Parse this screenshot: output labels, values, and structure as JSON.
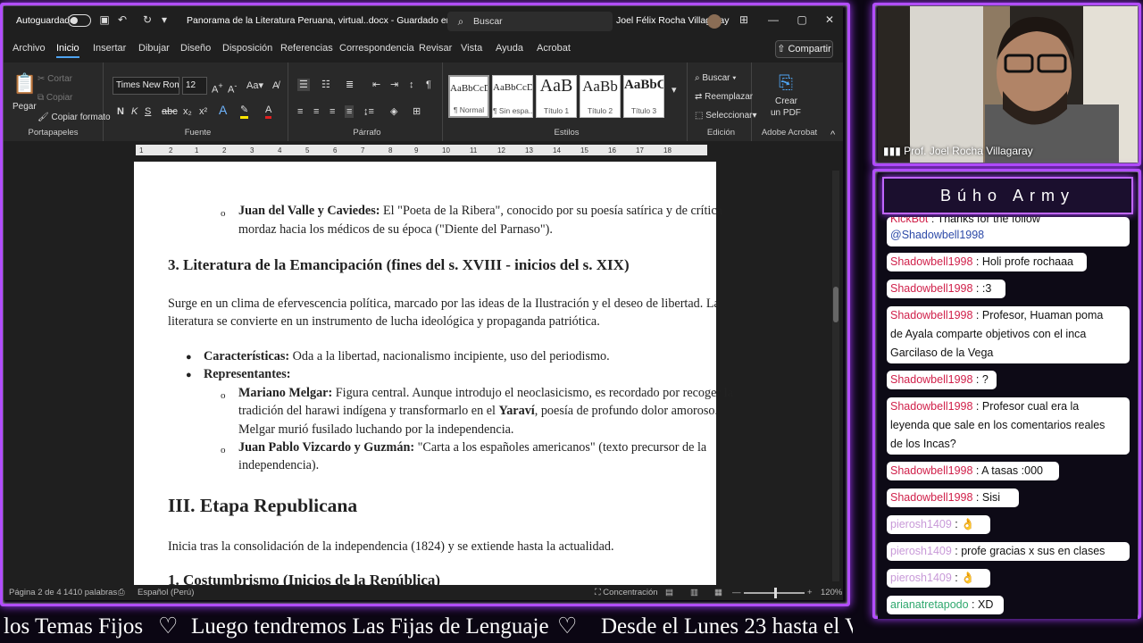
{
  "word": {
    "autosave_label": "Autoguardado",
    "doc_title": "Panorama de la Literatura Peruana, virtual..docx  -  Guardado en Este PC  ▾",
    "search_placeholder": "Buscar",
    "user_name": "Joel Félix Rocha Villagaray",
    "menu": [
      "Archivo",
      "Inicio",
      "Insertar",
      "Dibujar",
      "Diseño",
      "Disposición",
      "Referencias",
      "Correspondencia",
      "Revisar",
      "Vista",
      "Ayuda",
      "Acrobat"
    ],
    "share_label": "Compartir",
    "ribbon": {
      "clipboard": {
        "paste": "Pegar",
        "cut": "Cortar",
        "copy": "Copiar",
        "format_painter": "Copiar formato",
        "group": "Portapapeles"
      },
      "font": {
        "name": "Times New Roma",
        "size": "12",
        "group": "Fuente"
      },
      "paragraph": {
        "group": "Párrafo"
      },
      "styles": {
        "items": [
          {
            "preview": "AaBbCcDc",
            "name": "¶ Normal"
          },
          {
            "preview": "AaBbCcDc",
            "name": "¶ Sin espa..."
          },
          {
            "preview": "AaB",
            "name": "Título 1"
          },
          {
            "preview": "AaBb",
            "name": "Título 2"
          },
          {
            "preview": "AaBbC",
            "name": "Título 3"
          }
        ],
        "group": "Estilos"
      },
      "editing": {
        "find": "Buscar",
        "replace": "Reemplazar",
        "select": "Seleccionar",
        "group": "Edición"
      },
      "acrobat": {
        "create_pdf_1": "Crear",
        "create_pdf_2": "un PDF",
        "group": "Adobe Acrobat"
      }
    },
    "ruler_ticks": [
      "1",
      "2",
      "1",
      "2",
      "3",
      "4",
      "5",
      "6",
      "7",
      "8",
      "9",
      "10",
      "11",
      "12",
      "13",
      "14",
      "15",
      "16",
      "17",
      "18"
    ],
    "document": {
      "sub1_name": "Juan del Valle y Caviedes:",
      "sub1_line1": " El \"Poeta de la Ribera\", conocido por su poesía satírica y de crítica",
      "sub1_line2": "mordaz hacia los médicos de su época (\"Diente del Parnaso\").",
      "section3_heading": "3. Literatura de la Emancipación (fines del s. XVIII - inicios del s. XIX)",
      "section3_p1": "Surge en un clima de efervescencia política, marcado por las ideas de la Ilustración y el deseo de libertad. La",
      "section3_p2": "literatura se convierte en un instrumento de lucha ideológica y propaganda patriótica.",
      "bullet1_label": "Características:",
      "bullet1_text": " Oda a la libertad, nacionalismo incipiente, uso del periodismo.",
      "bullet2_label": "Representantes:",
      "melgar_name": "Mariano Melgar:",
      "melgar_l1": " Figura central. Aunque introdujo el neoclasicismo, es recordado por recoger la",
      "melgar_l2a": "tradición del harawi indígena y transformarlo en el ",
      "melgar_l2b": "Yaraví",
      "melgar_l2c": ", poesía de profundo dolor amoroso.",
      "melgar_l3": "Melgar murió fusilado luchando por la independencia.",
      "vizcardo_name": "Juan Pablo Vizcardo y Guzmán:",
      "vizcardo_l1": " \"Carta a los españoles americanos\" (texto precursor de la",
      "vizcardo_l2": "independencia).",
      "stage3_heading": "III. Etapa Republicana",
      "stage3_p": "Inicia tras la consolidación de la independencia (1824) y se extiende hasta la actualidad.",
      "next_heading": "1. Costumbrismo (Inicios de la República)"
    },
    "status": {
      "page": "Página 2 de 4",
      "words": "1410 palabras",
      "language": "Español (Perú)",
      "focus": "Concentración",
      "zoom": "120%"
    }
  },
  "ticker": [
    "los Temas Fijos",
    "♡",
    "Luego tendremos Las Fijas de Lenguaje",
    "♡",
    "Desde el Lunes 23 hasta el V"
  ],
  "webcam": {
    "label": "Prof. Joel Rocha Villagaray"
  },
  "chat": {
    "title": "Búho Army",
    "messages": [
      {
        "user": "KickBot",
        "text": " : Thanks for the follow",
        "line2": "@Shadowbell1998",
        "kind": "kick"
      },
      {
        "user": "Shadowbell1998",
        "text": " : Holi profe rochaaa",
        "kind": "shadow"
      },
      {
        "user": "Shadowbell1998",
        "text": " : :3",
        "kind": "shadow"
      },
      {
        "user": "Shadowbell1998",
        "text": " : Profesor, Huaman poma",
        "line2": "de Ayala comparte objetivos con el inca",
        "line3": "Garcilaso de la Vega",
        "kind": "shadow"
      },
      {
        "user": "Shadowbell1998",
        "text": " : ?",
        "kind": "shadow"
      },
      {
        "user": "Shadowbell1998",
        "text": " : Profesor cual era la",
        "line2": "leyenda que sale en los comentarios reales",
        "line3": "de los Incas?",
        "kind": "shadow"
      },
      {
        "user": "Shadowbell1998",
        "text": " : A tasas :000",
        "kind": "shadow"
      },
      {
        "user": "Shadowbell1998",
        "text": " : Sisi",
        "kind": "shadow"
      },
      {
        "user": "pierosh1409",
        "text": " : ",
        "emote": "👌",
        "kind": "piero"
      },
      {
        "user": "pierosh1409",
        "text": " : profe gracias x sus en clases",
        "kind": "piero"
      },
      {
        "user": "pierosh1409",
        "text": " : ",
        "emote": "👌",
        "kind": "piero"
      },
      {
        "user": "arianatretapodo",
        "text": " : XD",
        "kind": "ari"
      }
    ]
  },
  "colors": {
    "neon": "#b24dff",
    "word_dark": "#1f1f1f",
    "ribbon": "#292929",
    "accent": "#4ea3f0"
  }
}
